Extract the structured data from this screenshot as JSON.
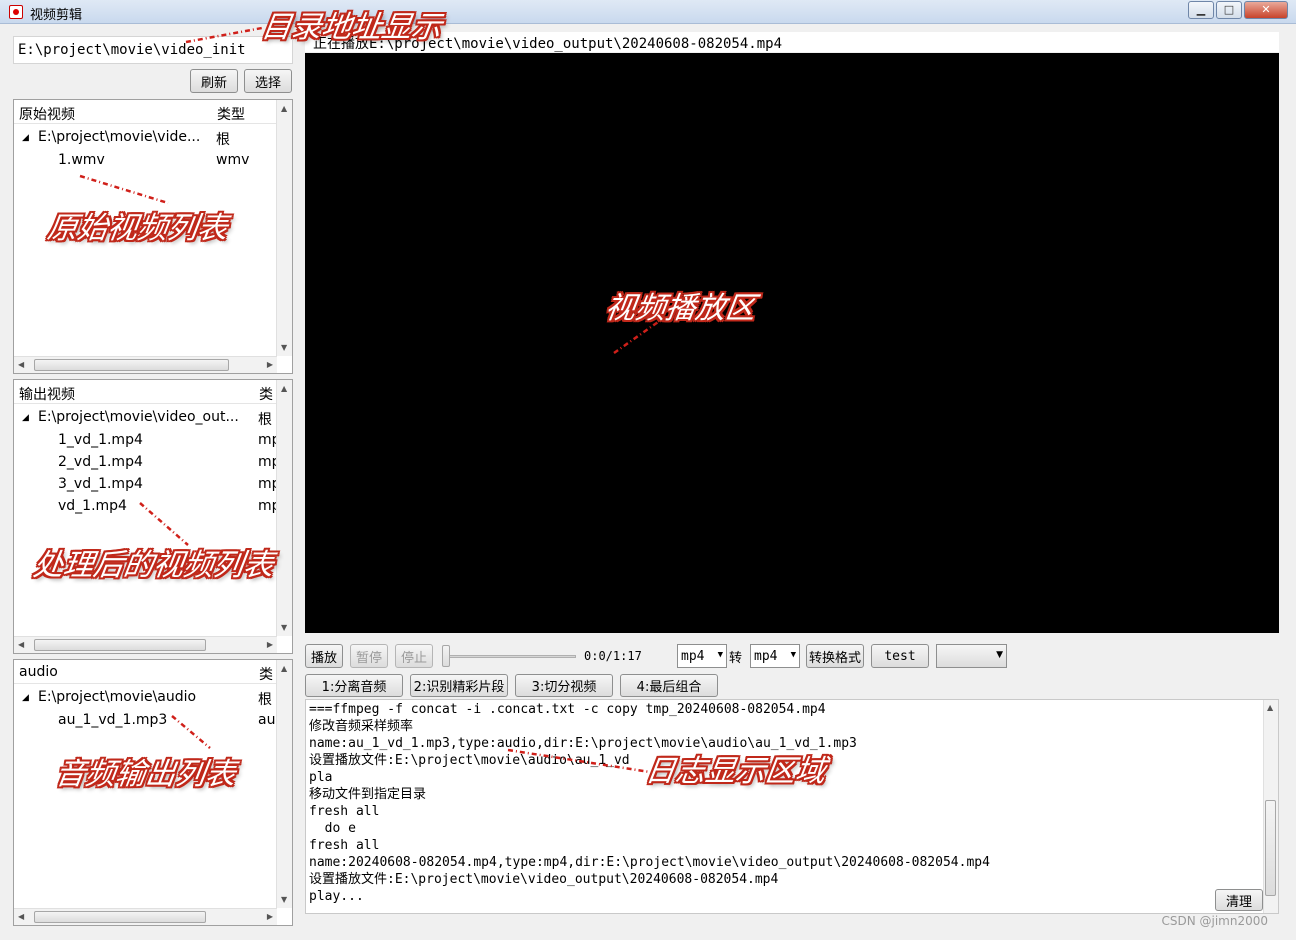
{
  "window": {
    "title": "视频剪辑",
    "min_label": "▁",
    "max_label": "□",
    "close_label": "✕"
  },
  "path_input": {
    "value": "E:\\project\\movie\\video_init"
  },
  "buttons": {
    "refresh": "刷新",
    "select": "选择",
    "clear": "清理"
  },
  "source_tree": {
    "headers": [
      "原始视频",
      "类型"
    ],
    "root": {
      "name": "E:\\project\\movie\\vide...",
      "type": "根"
    },
    "items": [
      {
        "name": "1.wmv",
        "type": "wmv"
      }
    ]
  },
  "output_tree": {
    "headers": [
      "输出视频",
      "类"
    ],
    "root": {
      "name": "E:\\project\\movie\\video_out...",
      "type": "根"
    },
    "items": [
      {
        "name": "1_vd_1.mp4",
        "type": "mp"
      },
      {
        "name": "2_vd_1.mp4",
        "type": "mp"
      },
      {
        "name": "3_vd_1.mp4",
        "type": "mp"
      },
      {
        "name": "vd_1.mp4",
        "type": "mp"
      }
    ]
  },
  "audio_tree": {
    "headers": [
      "audio",
      "类"
    ],
    "root": {
      "name": "E:\\project\\movie\\audio",
      "type": "根"
    },
    "items": [
      {
        "name": "au_1_vd_1.mp3",
        "type": "au"
      }
    ]
  },
  "player": {
    "status_text": "正在播放E:\\project\\movie\\video_output\\20240608-082054.mp4",
    "time": "0:0/1:17",
    "progress": 0.0
  },
  "controls": {
    "play": "播放",
    "pause": "暂停",
    "stop": "停止",
    "from_format": "mp4",
    "to_label": "转",
    "to_format": "mp4",
    "convert": "转换格式",
    "test": "test",
    "extra_combo": ""
  },
  "steps": [
    "1:分离音频",
    "2:识别精彩片段",
    "3:切分视频",
    "4:最后组合"
  ],
  "log": [
    "===ffmpeg -f concat -i .concat.txt -c copy tmp_20240608-082054.mp4",
    "修改音频采样频率",
    "name:au_1_vd_1.mp3,type:audio,dir:E:\\project\\movie\\audio\\au_1_vd_1.mp3",
    "设置播放文件:E:\\project\\movie\\audio\\au_1_vd",
    "pla",
    "移动文件到指定目录",
    "fresh all",
    "  do e",
    "fresh all",
    "name:20240608-082054.mp4,type:mp4,dir:E:\\project\\movie\\video_output\\20240608-082054.mp4",
    "设置播放文件:E:\\project\\movie\\video_output\\20240608-082054.mp4",
    "play..."
  ],
  "annotations": {
    "path": "目录地址显示",
    "source_list": "原始视频列表",
    "output_list": "处理后的视频列表",
    "audio_list": "音频输出列表",
    "player": "视频播放区",
    "log": "日志显示区域"
  },
  "watermark": "CSDN @jimn2000",
  "colors": {
    "annotation_outline": "#c0281a",
    "video_bg": "#000000"
  }
}
